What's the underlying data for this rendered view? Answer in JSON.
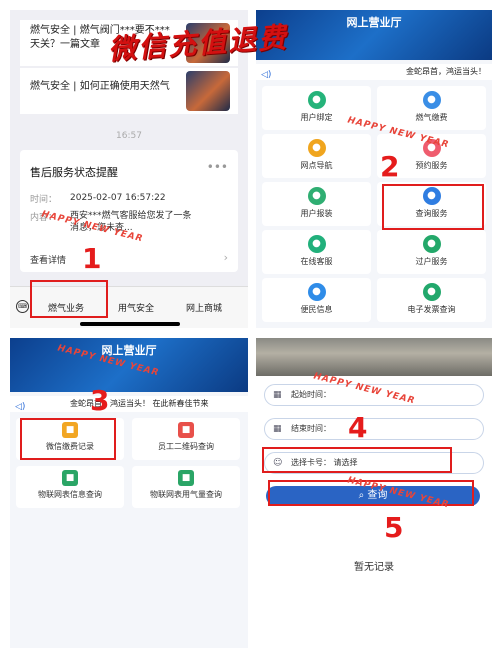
{
  "headline": "微信充值退费",
  "watermark": "HAPPY NEW YEAR",
  "steps": [
    "1",
    "2",
    "3",
    "4",
    "5"
  ],
  "panel1": {
    "news1_line1": "燃气安全 | 燃气阀门***要不***",
    "news1_line2": "天关？一篇文章",
    "news2": "燃气安全 | 如何正确使用天然气",
    "time_sep": "16:57",
    "card": {
      "title": "售后服务状态提醒",
      "time_label": "时间：",
      "time_value": "2025-02-07 16:57:22",
      "content_label": "内容：",
      "content_value": "西安***燃气客服给您发了一条消息，您未查...",
      "details": "查看详情"
    },
    "tabs": [
      "燃气业务",
      "用气安全",
      "网上商城"
    ]
  },
  "panel2": {
    "title": "网上营业厅",
    "marquee": "金蛇昂首，鸿运当头！",
    "services": [
      {
        "label": "用户绑定",
        "icon": "user-bind-icon",
        "color": "#25b37a"
      },
      {
        "label": "燃气缴费",
        "icon": "gas-fee-icon",
        "color": "#3a8ee6"
      },
      {
        "label": "网点导航",
        "icon": "location-pin-icon",
        "color": "#f0a51e"
      },
      {
        "label": "预约服务",
        "icon": "appointment-icon",
        "color": "#ef5c6e"
      },
      {
        "label": "用户报装",
        "icon": "wrench-icon",
        "color": "#2fae72"
      },
      {
        "label": "查询服务",
        "icon": "search-icon",
        "color": "#2f7de1"
      },
      {
        "label": "在线客服",
        "icon": "customer-service-icon",
        "color": "#21b07b"
      },
      {
        "label": "过户服务",
        "icon": "transfer-icon",
        "color": "#23a86a"
      },
      {
        "label": "便民信息",
        "icon": "info-bubble-icon",
        "color": "#2f8ce8"
      },
      {
        "label": "电子发票查询",
        "icon": "invoice-icon",
        "color": "#22a86c"
      }
    ]
  },
  "panel3": {
    "title": "网上营业厅",
    "marquee": "金蛇昂首，鸿运当头！  在此新春佳节来",
    "services": [
      {
        "label": "微信缴费记录",
        "icon": "wechat-payment-icon",
        "color": "#f2a623"
      },
      {
        "label": "员工二维码查询",
        "icon": "qr-code-icon",
        "color": "#e8504a"
      },
      {
        "label": "物联网表信息查询",
        "icon": "iot-meter-icon",
        "color": "#2aa566"
      },
      {
        "label": "物联网表用气量查询",
        "icon": "gas-usage-icon",
        "color": "#2aa566"
      }
    ]
  },
  "panel4": {
    "start_label": "起始时间：",
    "end_label": "结束时间：",
    "card_label": "选择卡号：",
    "card_placeholder": "请选择",
    "query_button": "查询",
    "empty": "暂无记录"
  }
}
